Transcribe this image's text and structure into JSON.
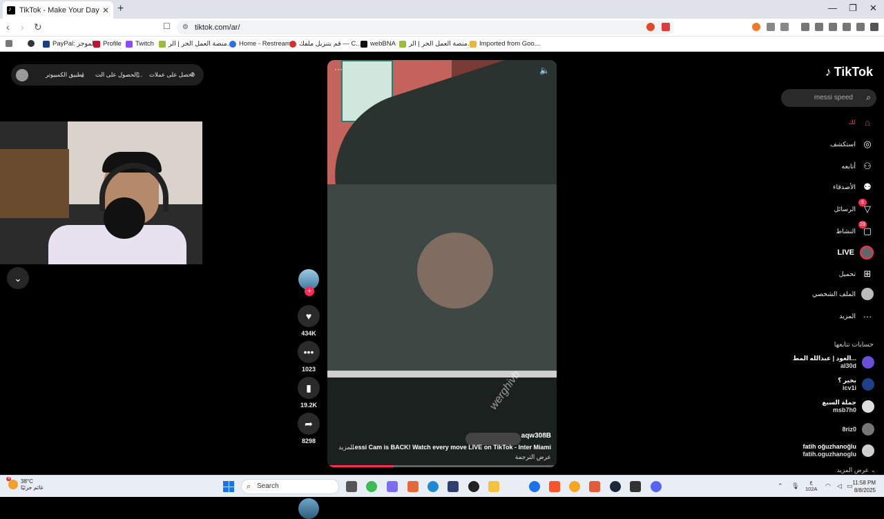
{
  "browser": {
    "tab_title": "TikTok - Make Your Day",
    "url": "tiktok.com/ar/",
    "bookmarks": [
      "PayPal: الموجز",
      "Profile",
      "Twitch",
      "منصة العمل الحر | الر...",
      "Home - Restream",
      "قم بتنزيل ملفك — C...",
      "webBNA",
      "منصة العمل الحر | الر...",
      "Imported from Goo..."
    ]
  },
  "top_pill": {
    "get_coins": "احصل على عملات",
    "get_app": "الحصول على الت...",
    "desktop_app": "تطبيق الكمبيوتر"
  },
  "video": {
    "username": "aqw308B",
    "caption": "...essi Cam is BACK! Watch every move LIVE on TikTok - Inter Miami",
    "more": "المزيد",
    "translate": "عرض الترجمة",
    "watermark": "werghivb",
    "progress": 0.29
  },
  "actions": {
    "likes": "434K",
    "comments": "1023",
    "saves": "19.2K",
    "shares": "8298"
  },
  "sidebar": {
    "logo": "TikTok",
    "search_value": "messi speed",
    "items": [
      {
        "label": "لك",
        "icon": "home-icon"
      },
      {
        "label": "استكشف",
        "icon": "compass-icon"
      },
      {
        "label": "أتابعه",
        "icon": "following-icon"
      },
      {
        "label": "الأصدقاء",
        "icon": "friends-icon"
      },
      {
        "label": "الرسائل",
        "icon": "send-icon",
        "badge": "6"
      },
      {
        "label": "النشاط",
        "icon": "activity-icon",
        "badge": "29"
      },
      {
        "label": "LIVE",
        "icon": "live-icon"
      },
      {
        "label": "تحميل",
        "icon": "upload-icon"
      },
      {
        "label": "الملف الشخصي",
        "icon": "profile-icon"
      },
      {
        "label": "المزيد",
        "icon": "more-icon"
      }
    ],
    "following_header": "حسابات تتابعها",
    "accounts": [
      {
        "name": "العود | عبدالله المط...",
        "handle": "al30d",
        "color": "#6b4fd6"
      },
      {
        "name": "بخير ؟",
        "handle": "icv1i",
        "color": "#1f3f8a"
      },
      {
        "name": "جملة السبع",
        "handle": "msb7h0",
        "color": "#dddddd"
      },
      {
        "name": "",
        "handle": "8riz0",
        "color": "#777777"
      },
      {
        "name": "fatih oğuzhanoğlu",
        "handle": "fatih.oguzhanoglu",
        "color": "#cfcfcf"
      }
    ],
    "show_more": "عرض المزيد"
  },
  "taskbar": {
    "temp": "38°C",
    "weather_text": "غائم جزئيًا",
    "weather_badge": "4",
    "search": "Search",
    "lang_top": "ع",
    "lang_bottom": "102A",
    "time": "11:58 PM",
    "date": "8/8/2025"
  }
}
